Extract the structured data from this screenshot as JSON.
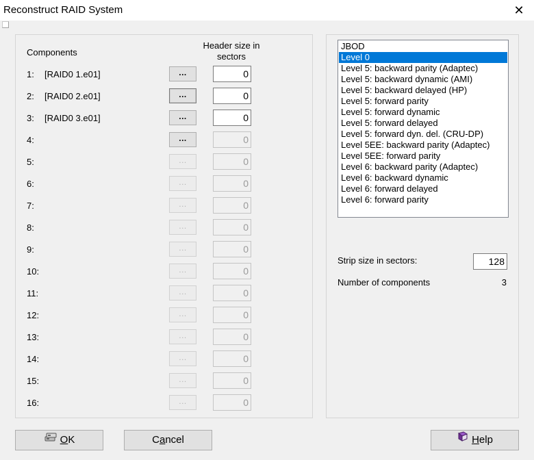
{
  "window": {
    "title": "Reconstruct RAID System",
    "close_glyph": "✕"
  },
  "components": {
    "header_label": "Components",
    "size_header": "Header size in sectors",
    "browse_label": "...",
    "rows": [
      {
        "num": "1:",
        "name": "[RAID0 1.e01]",
        "size": "0",
        "enabled": true
      },
      {
        "num": "2:",
        "name": "[RAID0 2.e01]",
        "size": "0",
        "enabled": true,
        "focused": true
      },
      {
        "num": "3:",
        "name": "[RAID0 3.e01]",
        "size": "0",
        "enabled": true
      },
      {
        "num": "4:",
        "name": "",
        "size": "0",
        "enabled": false,
        "browse_enabled": true
      },
      {
        "num": "5:",
        "name": "",
        "size": "0",
        "enabled": false
      },
      {
        "num": "6:",
        "name": "",
        "size": "0",
        "enabled": false
      },
      {
        "num": "7:",
        "name": "",
        "size": "0",
        "enabled": false
      },
      {
        "num": "8:",
        "name": "",
        "size": "0",
        "enabled": false
      },
      {
        "num": "9:",
        "name": "",
        "size": "0",
        "enabled": false
      },
      {
        "num": "10:",
        "name": "",
        "size": "0",
        "enabled": false
      },
      {
        "num": "11:",
        "name": "",
        "size": "0",
        "enabled": false
      },
      {
        "num": "12:",
        "name": "",
        "size": "0",
        "enabled": false
      },
      {
        "num": "13:",
        "name": "",
        "size": "0",
        "enabled": false
      },
      {
        "num": "14:",
        "name": "",
        "size": "0",
        "enabled": false
      },
      {
        "num": "15:",
        "name": "",
        "size": "0",
        "enabled": false
      },
      {
        "num": "16:",
        "name": "",
        "size": "0",
        "enabled": false
      }
    ]
  },
  "raid_levels": {
    "selected_index": 1,
    "items": [
      "JBOD",
      "Level 0",
      "Level 5: backward parity (Adaptec)",
      "Level 5: backward dynamic (AMI)",
      "Level 5: backward delayed (HP)",
      "Level 5: forward parity",
      "Level 5: forward dynamic",
      "Level 5: forward delayed",
      "Level 5: forward dyn. del. (CRU-DP)",
      "Level 5EE: backward parity (Adaptec)",
      "Level 5EE: forward parity",
      "Level 6: backward parity (Adaptec)",
      "Level 6: backward dynamic",
      "Level 6: forward delayed",
      "Level 6: forward parity"
    ]
  },
  "strip": {
    "label": "Strip size in sectors:",
    "value": "128"
  },
  "num_components": {
    "label": "Number of components",
    "value": "3"
  },
  "buttons": {
    "ok": {
      "accel": "O",
      "rest": "K",
      "icon": "disks-icon"
    },
    "cancel": {
      "pre": "C",
      "accel": "a",
      "rest": "ncel"
    },
    "help": {
      "accel": "H",
      "rest": "elp",
      "icon": "help-book-icon"
    }
  },
  "colors": {
    "selection": "#0078d7",
    "dialog_bg": "#f0f0f0",
    "help_icon": "#7b3fa0"
  }
}
